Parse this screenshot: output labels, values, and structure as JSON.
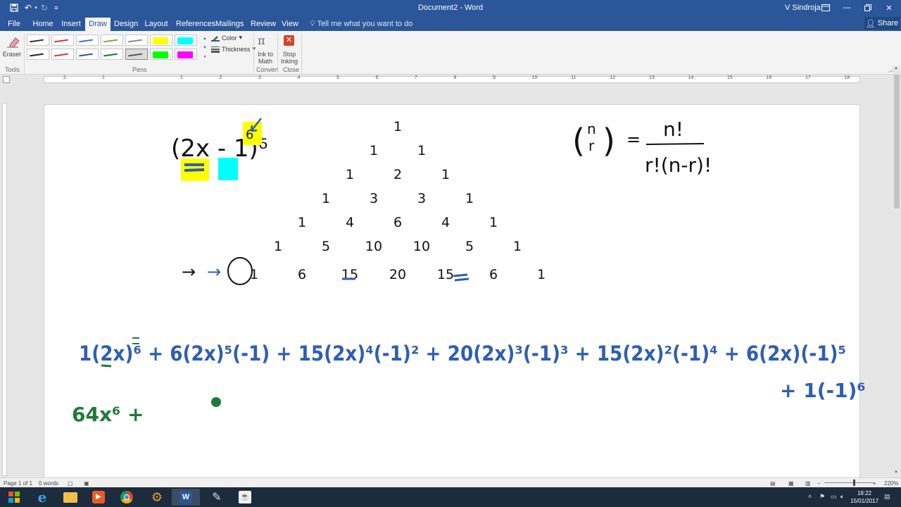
{
  "window": {
    "title": "Document2 - Word",
    "user": "V Sindroja",
    "titlebar_color": "#2b579a"
  },
  "tabs": [
    "File",
    "Home",
    "Insert",
    "Draw",
    "Design",
    "Layout",
    "References",
    "Mailings",
    "Review",
    "View"
  ],
  "active_tab": "Draw",
  "tell_me": "Tell me what you want to do",
  "share_label": "Share",
  "ribbon": {
    "eraser_label": "Eraser",
    "tools_label": "Tools",
    "pens_label": "Pens",
    "color_label": "Color",
    "thickness_label": "Thickness",
    "ink_to_math_label_1": "Ink to",
    "ink_to_math_label_2": "Math",
    "convert_label": "Convert",
    "stop_inking_label_1": "Stop",
    "stop_inking_label_2": "Inking",
    "close_label": "Close",
    "pen_colors": [
      "#333333",
      "#d13438",
      "#4472c4",
      "#70ad47",
      "#888888",
      "#ffff00",
      "#00ffff",
      "#222222",
      "#d13438",
      "#2f5597",
      "#107c10",
      "#555555",
      "#00ff00",
      "#ff00ff"
    ]
  },
  "ruler": {
    "numbers": [
      "2",
      "1",
      "1",
      "2",
      "3",
      "4",
      "5",
      "6",
      "7",
      "8",
      "9",
      "10",
      "11",
      "12",
      "13",
      "14",
      "15",
      "16",
      "17",
      "18"
    ]
  },
  "document": {
    "binomial_expr": "(2x - 1)⁶",
    "exponent": "6",
    "pascal_rows": [
      [
        "1"
      ],
      [
        "1",
        "1"
      ],
      [
        "1",
        "2",
        "1"
      ],
      [
        "1",
        "3",
        "3",
        "1"
      ],
      [
        "1",
        "4",
        "6",
        "4",
        "1"
      ],
      [
        "1",
        "5",
        "10",
        "10",
        "5",
        "1"
      ],
      [
        "1",
        "6",
        "15",
        "20",
        "15",
        "6",
        "1"
      ]
    ],
    "formula_lhs_n": "n",
    "formula_lhs_r": "r",
    "formula_eq": "=",
    "formula_num": "n!",
    "formula_den": "r!(n-r)!",
    "arrow": "→",
    "expansion_line1": "1(2x)⁶ + 6(2x)⁵(-1) + 15(2x)⁴(-1)² + 20(2x)³(-1)³ + 15(2x)²(-1)⁴ + 6(2x)(-1)⁵",
    "expansion_line2": "+ 1(-1)⁶",
    "result_line": "64x⁶   +",
    "ink_blue": "#2e5fb0",
    "ink_green": "#1f7a3a"
  },
  "status": {
    "page": "Page 1 of 1",
    "words": "0 words",
    "zoom": "220%"
  },
  "taskbar": {
    "time": "18:22",
    "date": "15/01/2017",
    "apps": [
      "windows-start",
      "internet-explorer",
      "file-explorer",
      "media-player",
      "chrome",
      "settings-app",
      "word",
      "draw-app",
      "java-app"
    ]
  }
}
